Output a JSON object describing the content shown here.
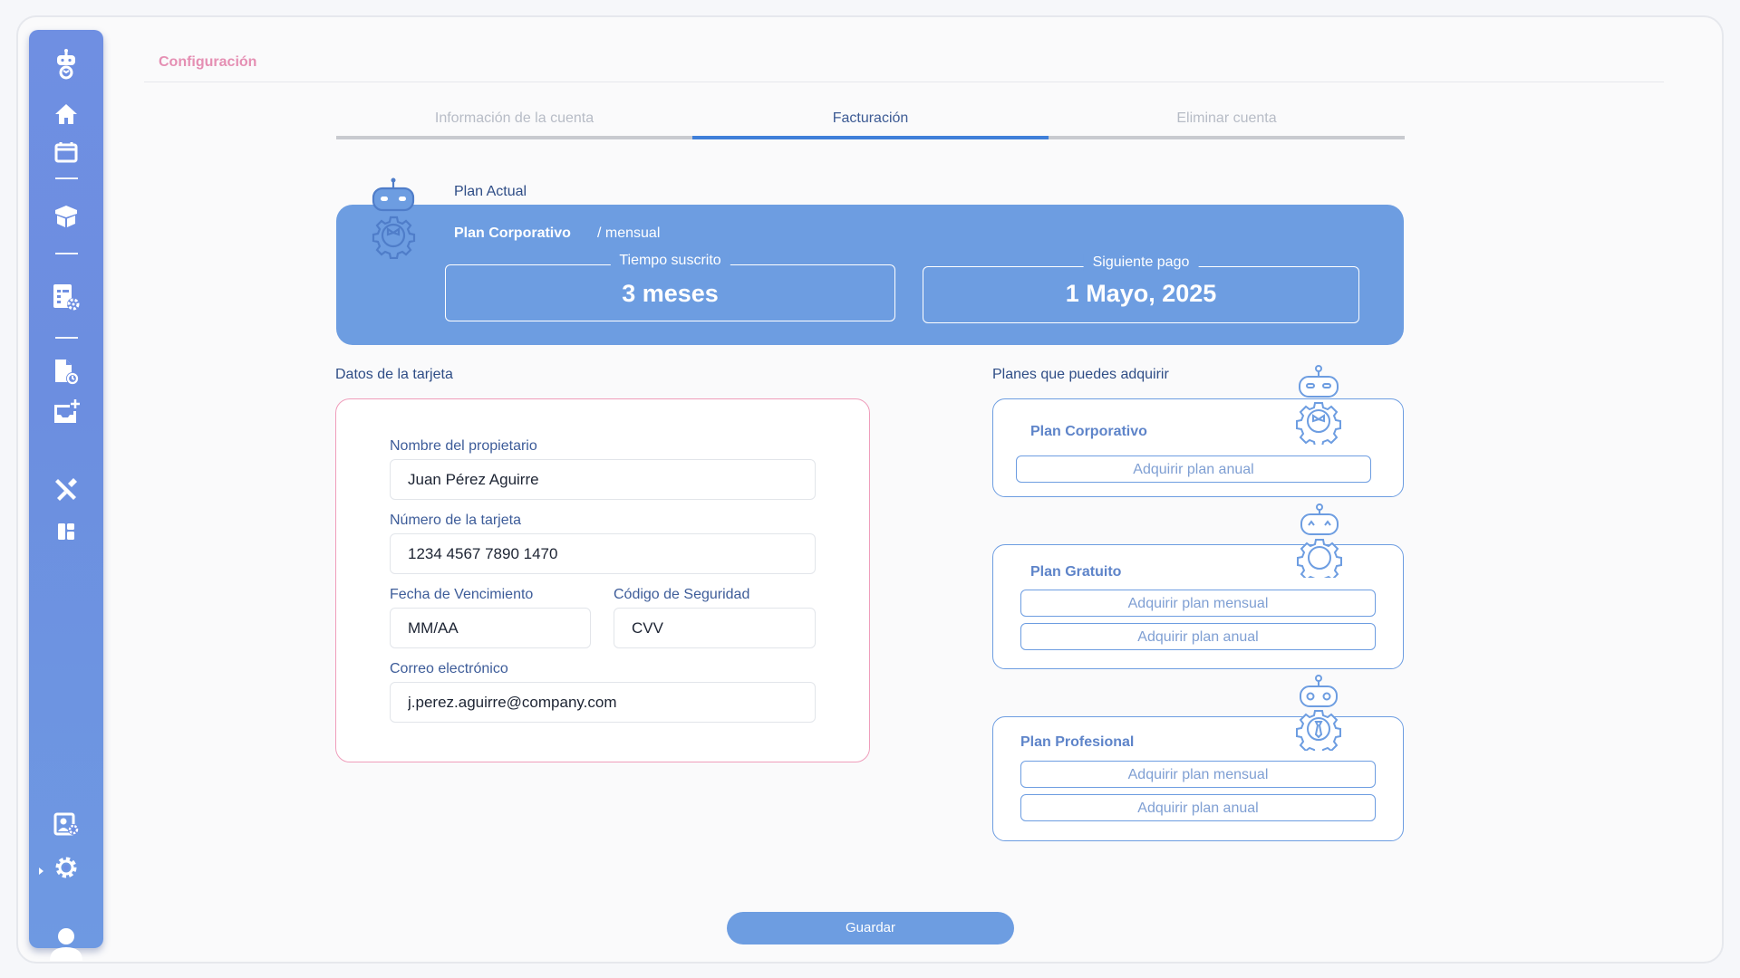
{
  "app": {
    "page_title": "Configuración",
    "accent_color": "#6d9de1",
    "title_color": "#e58fb3"
  },
  "sidebar": {
    "items": [
      {
        "icon": "robot-logo-icon"
      },
      {
        "icon": "home-icon"
      },
      {
        "icon": "calendar-icon"
      },
      {
        "icon": "box-icon"
      },
      {
        "icon": "report-settings-icon"
      },
      {
        "icon": "document-clock-icon"
      },
      {
        "icon": "inbox-add-icon"
      },
      {
        "icon": "tools-icon"
      },
      {
        "icon": "dashboard-icon"
      },
      {
        "icon": "user-settings-icon"
      },
      {
        "icon": "gear-icon"
      },
      {
        "icon": "user-avatar-icon"
      }
    ]
  },
  "tabs": [
    {
      "label": "Información de la cuenta",
      "active": false
    },
    {
      "label": "Facturación",
      "active": true
    },
    {
      "label": "Eliminar cuenta",
      "active": false
    }
  ],
  "current_plan": {
    "section_label": "Plan Actual",
    "name": "Plan Corporativo",
    "period": "/ mensual",
    "subscribed_label": "Tiempo suscrito",
    "subscribed_value": "3 meses",
    "next_payment_label": "Siguiente pago",
    "next_payment_value": "1 Mayo, 2025"
  },
  "card": {
    "section_title": "Datos de la tarjeta",
    "owner_label": "Nombre del propietario",
    "owner_value": "Juan Pérez Aguirre",
    "number_label": "Número de la tarjeta",
    "number_value": "1234 4567 7890 1470",
    "expiry_label": "Fecha de Vencimiento",
    "expiry_placeholder": "MM/AA",
    "cvv_label": "Código de Seguridad",
    "cvv_placeholder": "CVV",
    "email_label": "Correo electrónico",
    "email_value": "j.perez.aguirre@company.com"
  },
  "plans": {
    "section_title": "Planes que puedes adquirir",
    "items": [
      {
        "name": "Plan Corporativo",
        "buttons": [
          "Adquirir plan anual"
        ]
      },
      {
        "name": "Plan Gratuito",
        "buttons": [
          "Adquirir plan mensual",
          "Adquirir plan anual"
        ]
      },
      {
        "name": "Plan Profesional",
        "buttons": [
          "Adquirir plan mensual",
          "Adquirir plan anual"
        ]
      }
    ]
  },
  "actions": {
    "save_label": "Guardar"
  }
}
